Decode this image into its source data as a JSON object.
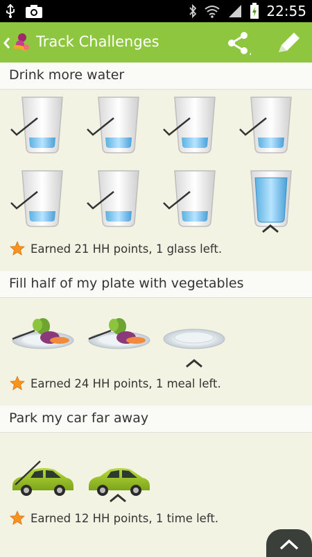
{
  "statusbar": {
    "time": "22:55",
    "icons": [
      "usb-icon",
      "camera-icon",
      "bluetooth-icon",
      "wifi-icon",
      "signal-icon",
      "battery-icon"
    ]
  },
  "header": {
    "title": "Track Challenges",
    "icons": [
      "back-chevron-icon",
      "app-logo-icon",
      "share-icon",
      "edit-pencil-icon"
    ]
  },
  "colors": {
    "accent": "#8ec63f",
    "background": "#f3f3e3",
    "star": "#f7941d"
  },
  "challenges": [
    {
      "title": "Drink more water",
      "earned": "Earned 21 HH points, 1 glass left."
    },
    {
      "title": "Fill half of my plate with vegetables",
      "earned": "Earned 24 HH points, 1 meal left."
    },
    {
      "title": "Park my car far away",
      "earned": "Earned 12 HH points, 1 time left."
    }
  ]
}
